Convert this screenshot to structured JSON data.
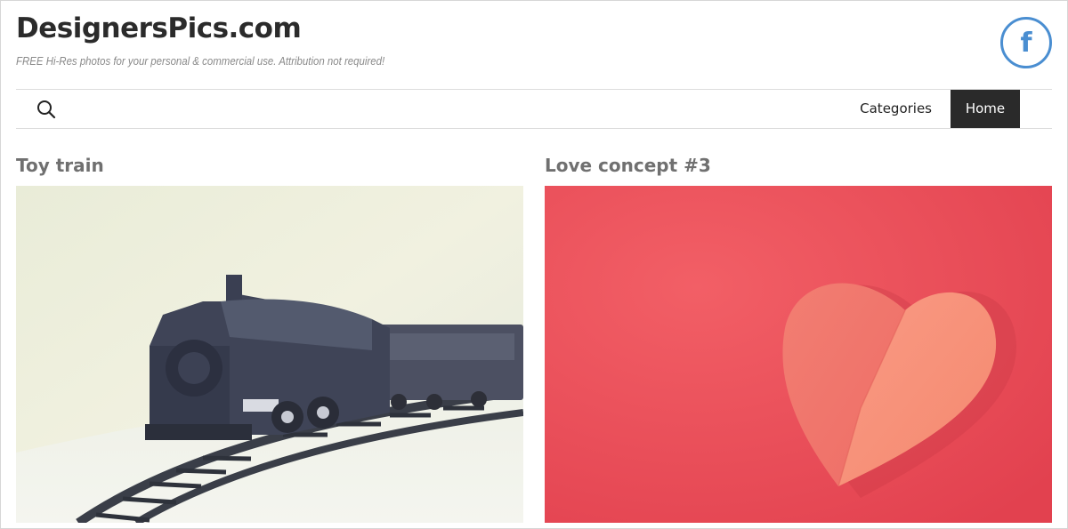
{
  "header": {
    "site_title": "DesignersPics.com",
    "tagline": "FREE Hi-Res photos for your personal & commercial use. Attribution not required!",
    "social_icon": "facebook-icon",
    "social_glyph": "f",
    "brand_color": "#4a8ed1"
  },
  "nav": {
    "search_icon": "search-icon",
    "items": [
      {
        "label": "Categories",
        "active": false
      },
      {
        "label": "Home",
        "active": true
      }
    ]
  },
  "posts": [
    {
      "title": "Toy train",
      "image": "toy-train-photo"
    },
    {
      "title": "Love concept #3",
      "image": "paper-heart-photo"
    }
  ]
}
